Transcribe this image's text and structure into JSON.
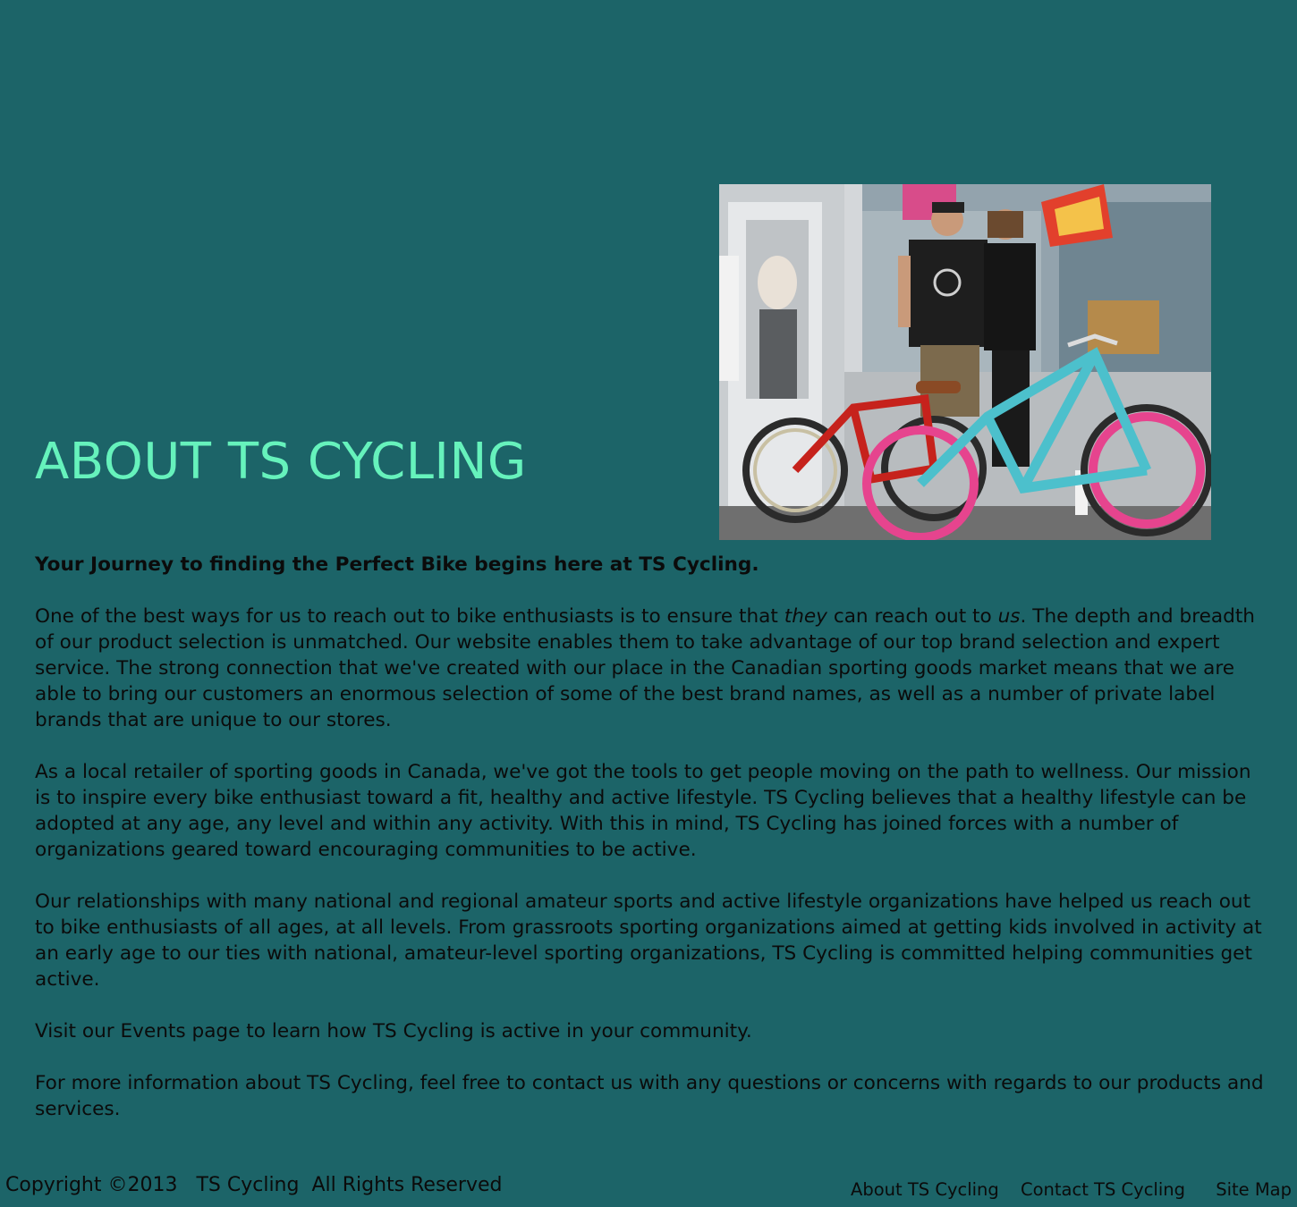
{
  "page": {
    "title": "ABOUT TS CYCLING"
  },
  "hero_image": {
    "description_icon": "photo-couple-with-cruiser-bikes"
  },
  "content": {
    "lead": "Your Journey to finding the Perfect Bike begins here at TS Cycling.",
    "p1_a": "One of the best ways for us to reach out to bike enthusiasts is to ensure that ",
    "p1_em1": "they",
    "p1_b": " can reach out to ",
    "p1_em2": "us",
    "p1_c": ". The depth and breadth of our product selection is unmatched. Our website enables them to take advantage of our top brand selection and expert service. The strong connection that we've created with our place in the Canadian sporting goods market means that we are able to bring our customers an enormous selection of some of the best brand names, as well as a number of private label brands that are unique to our stores.",
    "p2": "As a local retailer of sporting goods in Canada, we've got the tools to get people moving on the path to wellness. Our mission is to inspire every bike enthusiast toward a fit, healthy and active lifestyle. TS Cycling believes that a healthy lifestyle can be adopted at any age, any level and within any activity. With this in mind, TS Cycling has joined forces with a number of organizations geared toward encouraging communities to be active.",
    "p3": "Our relationships with many national and regional amateur sports and active lifestyle organizations have helped us reach out to bike enthusiasts of all ages, at all levels. From grassroots sporting organizations aimed at getting kids involved in activity at an early age to our ties with national, amateur-level sporting organizations, TS Cy­cling is committed helping communities get active.",
    "p4": "Visit our Events page to learn how TS Cycling is active in your community.",
    "p5": "For more information about TS Cycling, feel free to contact us with any questions or concerns with regards to our products and services."
  },
  "footer": {
    "copyright": "Copyright ©2013   TS Cycling  All Rights Reserved",
    "links": {
      "about": "About TS Cycling",
      "contact": "Contact TS Cycling",
      "sitemap": "Site Map"
    }
  },
  "colors": {
    "background": "#1c6468",
    "title": "#66f2bc",
    "text": "#0b0b0b"
  }
}
